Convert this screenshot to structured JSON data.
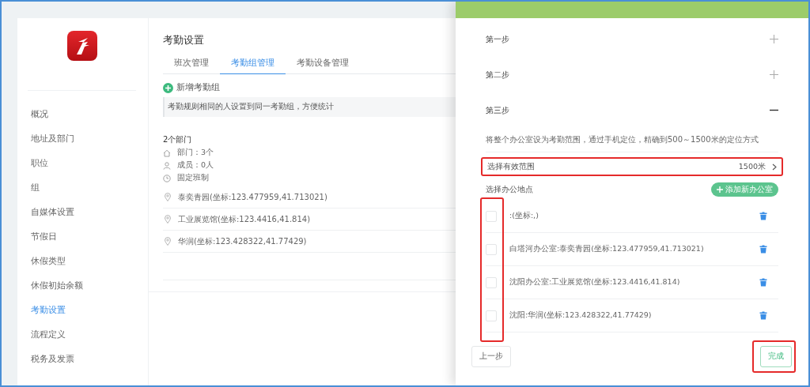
{
  "sidebar": {
    "items": [
      {
        "label": "概况",
        "selected": false
      },
      {
        "label": "地址及部门",
        "selected": false
      },
      {
        "label": "职位",
        "selected": false
      },
      {
        "label": "组",
        "selected": false
      },
      {
        "label": "自媒体设置",
        "selected": false
      },
      {
        "label": "节假日",
        "selected": false
      },
      {
        "label": "休假类型",
        "selected": false
      },
      {
        "label": "休假初始余额",
        "selected": false
      },
      {
        "label": "考勤设置",
        "selected": true
      },
      {
        "label": "流程定义",
        "selected": false
      },
      {
        "label": "税务及发票",
        "selected": false
      }
    ]
  },
  "main": {
    "title": "考勤设置",
    "tabs": [
      {
        "label": "班次管理",
        "selected": false
      },
      {
        "label": "考勤组管理",
        "selected": true
      },
      {
        "label": "考勤设备管理",
        "selected": false
      }
    ],
    "add_button": "新增考勤组",
    "notice": "考勤规则相同的人设置到同一考勤组，方便统计",
    "group": {
      "name": "2个部门",
      "details": [
        {
          "kind": "department",
          "text": "部门：3个"
        },
        {
          "kind": "members",
          "text": "成员：0人"
        },
        {
          "kind": "schedule",
          "text": "固定班制"
        }
      ],
      "locations": [
        "泰奕青园(坐标:123.477959,41.713021)",
        "工业展览馆(坐标:123.4416,41.814)",
        "华润(坐标:123.428322,41.77429)"
      ]
    }
  },
  "drawer": {
    "steps": [
      {
        "label": "第一步",
        "expanded": false
      },
      {
        "label": "第二步",
        "expanded": false
      },
      {
        "label": "第三步",
        "expanded": true
      }
    ],
    "description": "将整个办公室设为考勤范围，通过手机定位，精确到500～1500米的定位方式",
    "range": {
      "label": "选择有效范围",
      "value": "1500米"
    },
    "offices_label": "选择办公地点",
    "add_office_button": "添加新办公室",
    "offices": [
      {
        "text": ":(坐标:,)",
        "checked": false
      },
      {
        "text": "白塔河办公室:泰奕青园(坐标:123.477959,41.713021)",
        "checked": false
      },
      {
        "text": "沈阳办公室:工业展览馆(坐标:123.4416,41.814)",
        "checked": false
      },
      {
        "text": "沈阳:华润(坐标:123.428322,41.77429)",
        "checked": false
      }
    ],
    "back_button": "上一步",
    "finish_button": "完成"
  }
}
